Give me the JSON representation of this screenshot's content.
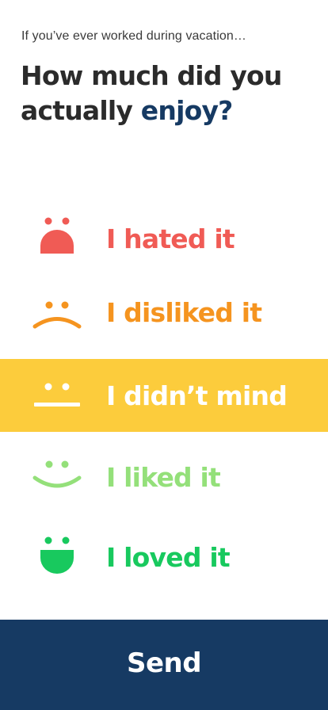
{
  "header": {
    "eyebrow": "If you’ve ever worked during vacation…",
    "question_part1": "How much did you actually ",
    "question_accent": "enjoy?"
  },
  "options": [
    {
      "label": "I hated it",
      "icon": "very-sad-face-icon",
      "color": "#f05b55",
      "selected": false
    },
    {
      "label": "I disliked it",
      "icon": "sad-face-icon",
      "color": "#f5941f",
      "selected": false
    },
    {
      "label": "I didn’t mind",
      "icon": "neutral-face-icon",
      "color": "#ffffff",
      "background": "#fccc3c",
      "selected": true
    },
    {
      "label": "I liked it",
      "icon": "smile-face-icon",
      "color": "#94e07a",
      "selected": false
    },
    {
      "label": "I loved it",
      "icon": "big-smile-face-icon",
      "color": "#18c95e",
      "selected": false
    }
  ],
  "footer": {
    "send_label": "Send",
    "background": "#163a63"
  },
  "colors": {
    "accent": "#163a63",
    "text": "#2b2b2b"
  }
}
